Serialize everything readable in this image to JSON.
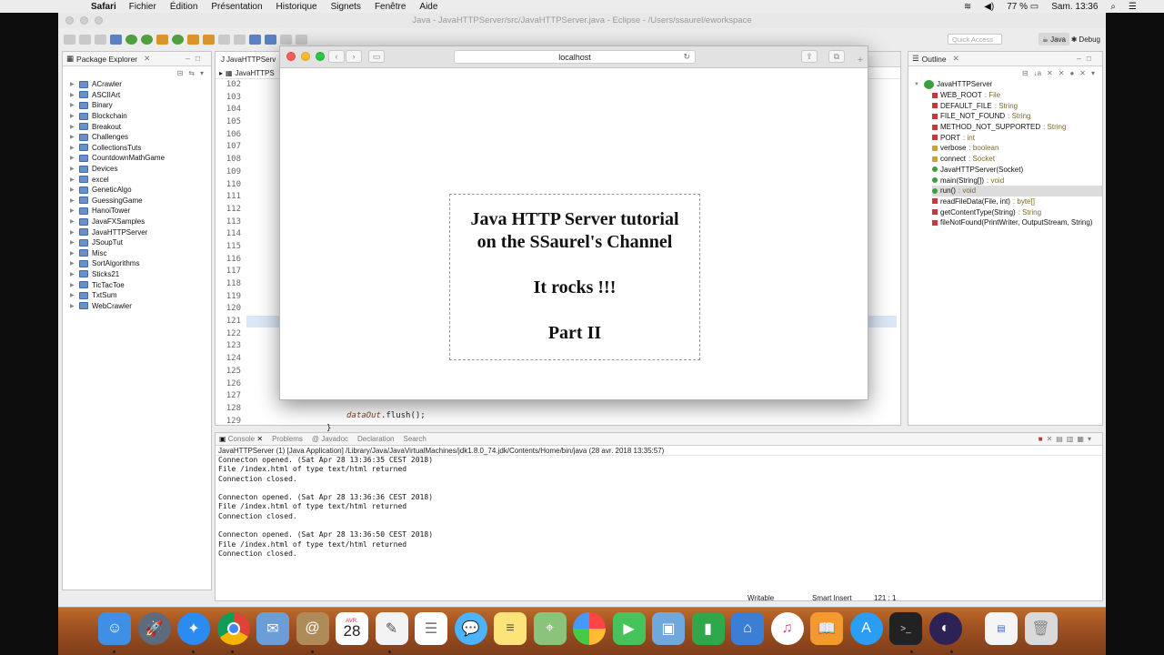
{
  "menubar": {
    "apple": "",
    "app": "Safari",
    "items": [
      "Fichier",
      "Édition",
      "Présentation",
      "Historique",
      "Signets",
      "Fenêtre",
      "Aide"
    ],
    "battery": "77 %",
    "clock": "Sam. 13:36"
  },
  "eclipse": {
    "title": "Java - JavaHTTPServer/src/JavaHTTPServer.java - Eclipse - /Users/ssaurel/eworkspace",
    "quick_access": "Quick Access",
    "perspective_java": "Java",
    "perspective_debug": "Debug"
  },
  "package_explorer": {
    "title": "Package Explorer",
    "projects": [
      "ACrawler",
      "ASCIIArt",
      "Binary",
      "Blockchain",
      "Breakout",
      "Challenges",
      "CollectionsTuts",
      "CountdownMathGame",
      "Devices",
      "excel",
      "GeneticAlgo",
      "GuessingGame",
      "HanoiTower",
      "JavaFXSamples",
      "JavaHTTPServer",
      "JSoupTut",
      "Misc",
      "SortAlgorithms",
      "Sticks21",
      "TicTacToe",
      "TxtSum",
      "WebCrawler"
    ]
  },
  "editor": {
    "tab": "JavaHTTPServ",
    "breadcrumb": "JavaHTTPS",
    "line_numbers": [
      "102",
      "103",
      "104",
      "105",
      "106",
      "107",
      "108",
      "109",
      "110",
      "111",
      "112",
      "113",
      "114",
      "115",
      "116",
      "117",
      "118",
      "119",
      "120",
      "121",
      "122",
      "123",
      "124",
      "125",
      "126",
      "127",
      "128",
      "129"
    ],
    "code_line_var": "dataOut",
    "code_line_call": ".flush();",
    "code_line_brace": "}"
  },
  "outline": {
    "title": "Outline",
    "class_name": "JavaHTTPServer",
    "members": [
      {
        "name": "WEB_ROOT",
        "type": " : File"
      },
      {
        "name": "DEFAULT_FILE",
        "type": " : String"
      },
      {
        "name": "FILE_NOT_FOUND",
        "type": " : String"
      },
      {
        "name": "METHOD_NOT_SUPPORTED",
        "type": " : String"
      },
      {
        "name": "PORT",
        "type": " : int"
      },
      {
        "name": "verbose",
        "type": " : boolean"
      },
      {
        "name": "connect",
        "type": " : Socket"
      },
      {
        "name": "JavaHTTPServer(Socket)",
        "type": ""
      },
      {
        "name": "main(String[])",
        "type": " : void"
      },
      {
        "name": "run()",
        "type": " : void"
      },
      {
        "name": "readFileData(File, int)",
        "type": " : byte[]"
      },
      {
        "name": "getContentType(String)",
        "type": " : String"
      },
      {
        "name": "fileNotFound(PrintWriter, OutputStream, String)",
        "type": ""
      }
    ]
  },
  "console": {
    "tabs": [
      "Console",
      "Problems",
      "Javadoc",
      "Declaration",
      "Search"
    ],
    "info": "JavaHTTPServer (1) [Java Application] /Library/Java/JavaVirtualMachines/jdk1.8.0_74.jdk/Contents/Home/bin/java (28 avr. 2018 13:35:57)",
    "output": "Connecton opened. (Sat Apr 28 13:36:35 CEST 2018)\nFile /index.html of type text/html returned\nConnection closed.\n\nConnecton opened. (Sat Apr 28 13:36:36 CEST 2018)\nFile /index.html of type text/html returned\nConnection closed.\n\nConnecton opened. (Sat Apr 28 13:36:50 CEST 2018)\nFile /index.html of type text/html returned\nConnection closed."
  },
  "statusbar": {
    "writable": "Writable",
    "insert_mode": "Smart Insert",
    "position": "121 : 1"
  },
  "safari": {
    "url": "localhost",
    "page": {
      "line1": "Java HTTP Server tutorial",
      "line2": "on the SSaurel's Channel",
      "line3": "It rocks !!!",
      "line4": "Part II"
    }
  },
  "dock": {
    "calendar_month": "AVR.",
    "calendar_day": "28",
    "apps": [
      "finder-icon",
      "launchpad-icon",
      "safari-icon",
      "chrome-icon",
      "mail-stamp-icon",
      "contacts-icon",
      "calendar-icon",
      "textedit-icon",
      "reminders-icon",
      "messages-icon",
      "notes-icon",
      "maps-icon",
      "photos-icon",
      "facetime-icon",
      "preview-icon",
      "numbers-icon",
      "keynote-icon",
      "itunes-icon",
      "ibooks-icon",
      "app-store-icon",
      "terminal-icon",
      "eclipse-icon",
      "document-icon",
      "trash-icon"
    ]
  }
}
